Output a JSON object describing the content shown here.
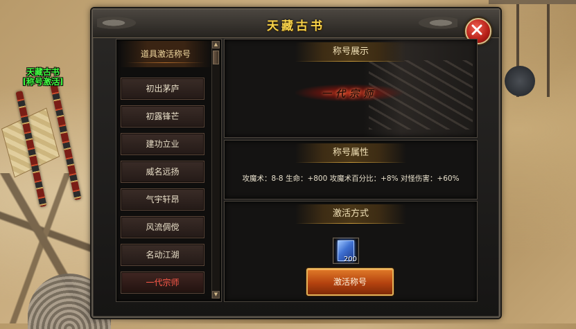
{
  "world": {
    "npc_title_line1": "天藏古书",
    "npc_title_line2": "[称号激活]"
  },
  "window": {
    "title": "天藏古书"
  },
  "title_list": {
    "header": "道具激活称号",
    "items": [
      {
        "label": "初出茅庐"
      },
      {
        "label": "初露锋芒"
      },
      {
        "label": "建功立业"
      },
      {
        "label": "威名远扬"
      },
      {
        "label": "气宇轩昂"
      },
      {
        "label": "风流倜傥"
      },
      {
        "label": "名动江湖"
      },
      {
        "label": "一代宗师"
      }
    ],
    "selected_index": 7
  },
  "display_section": {
    "header": "称号展示",
    "emblem_text": "一代宗师"
  },
  "attributes_section": {
    "header": "称号属性",
    "text": "攻魔术：8-8  生命：+800  攻魔术百分比：+8%  对怪伤害：+60%"
  },
  "activation_section": {
    "header": "激活方式",
    "item_count": "200",
    "activate_button": "激活称号"
  },
  "colors": {
    "title_gold": "#f7d24a",
    "npc_green": "#43ff43",
    "selected_red": "#ff5a4a",
    "button_orange": "#b4420f"
  },
  "icons": {
    "close": "close-x-icon",
    "item": "blue-book-icon",
    "scroll_up": "arrow-up-icon",
    "scroll_down": "arrow-down-icon"
  }
}
